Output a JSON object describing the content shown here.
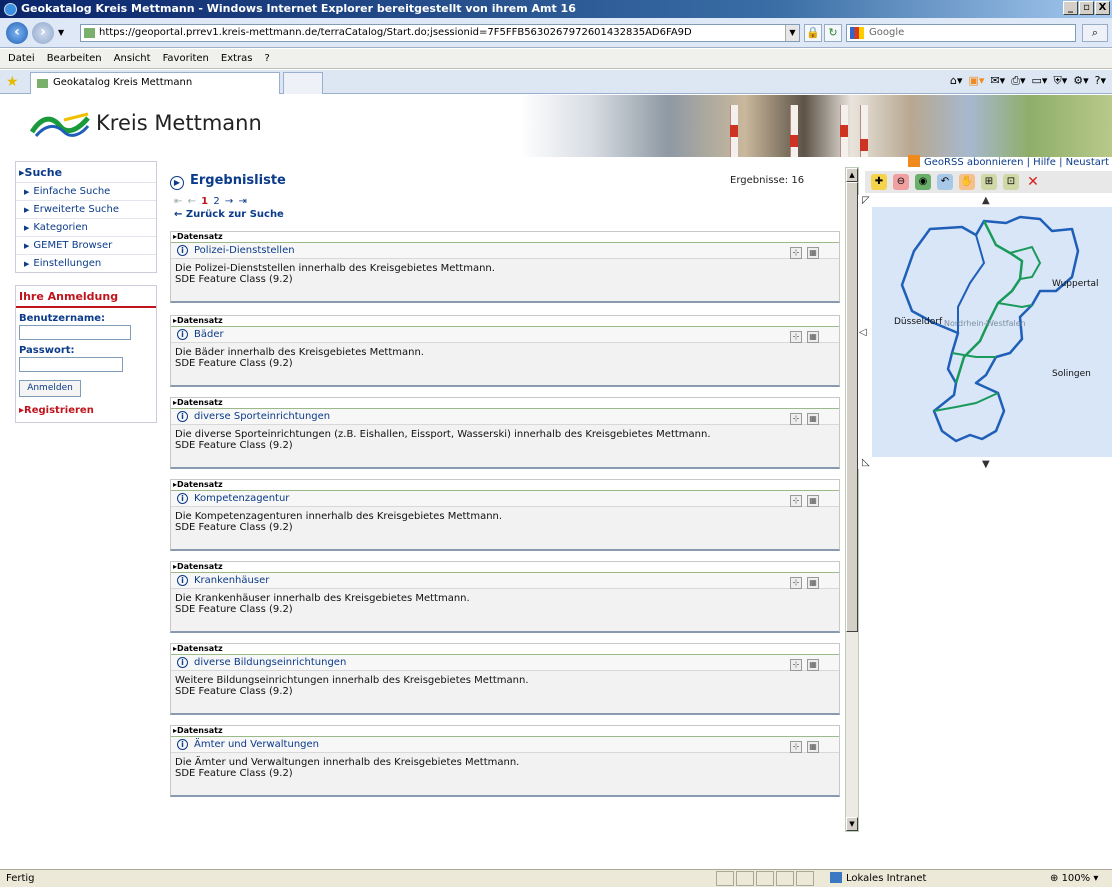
{
  "window": {
    "title": "Geokatalog Kreis Mettmann - Windows Internet Explorer bereitgestellt von ihrem Amt 16",
    "controls": [
      "_",
      "▫",
      "X"
    ]
  },
  "address": {
    "url": "https://geoportal.prrev1.kreis-mettmann.de/terraCatalog/Start.do;jsessionid=7F5FFB5630267972601432835AD6FA9D",
    "search_placeholder": "Google"
  },
  "menu": [
    "Datei",
    "Bearbeiten",
    "Ansicht",
    "Favoriten",
    "Extras",
    "?"
  ],
  "tab": {
    "label": "Geokatalog Kreis Mettmann"
  },
  "banner": {
    "brand": "Kreis Mettmann"
  },
  "sidebar": {
    "search_heading": "Suche",
    "items": [
      "Einfache Suche",
      "Erweiterte Suche",
      "Kategorien",
      "GEMET Browser",
      "Einstellungen"
    ],
    "login_heading": "Ihre Anmeldung",
    "username_label": "Benutzername:",
    "password_label": "Passwort:",
    "login_button": "Anmelden",
    "register_link": "Registrieren"
  },
  "results": {
    "title": "Ergebnisliste",
    "count_label": "Ergebnisse: 16",
    "pager": {
      "first": "⇤",
      "prev": "←",
      "current": "1",
      "next_page": "2",
      "next": "→",
      "last": "⇥"
    },
    "back_link": "← Zurück zur Suche",
    "record_header": "Datensatz",
    "records": [
      {
        "name": "Polizei-Dienststellen",
        "description": "Die Polizei-Dienststellen innerhalb des Kreisgebietes Mettmann.",
        "type": "SDE Feature Class (9.2)"
      },
      {
        "name": "Bäder",
        "description": "Die Bäder innerhalb des Kreisgebietes Mettmann.",
        "type": "SDE Feature Class (9.2)"
      },
      {
        "name": "diverse Sporteinrichtungen",
        "description": "Die diverse Sporteinrichtungen (z.B. Eishallen, Eissport, Wasserski) innerhalb des Kreisgebietes Mettmann.",
        "type": "SDE Feature Class (9.2)"
      },
      {
        "name": "Kompetenzagentur",
        "description": "Die Kompetenzagenturen innerhalb des Kreisgebietes Mettmann.",
        "type": "SDE Feature Class (9.2)"
      },
      {
        "name": "Krankenhäuser",
        "description": "Die Krankenhäuser innerhalb des Kreisgebietes Mettmann.",
        "type": "SDE Feature Class (9.2)"
      },
      {
        "name": "diverse Bildungseinrichtungen",
        "description": "Weitere Bildungseinrichtungen innerhalb des Kreisgebietes Mettmann.",
        "type": "SDE Feature Class (9.2)"
      },
      {
        "name": "Ämter und Verwaltungen",
        "description": "Die Ämter und Verwaltungen innerhalb des Kreisgebietes Mettmann.",
        "type": "SDE Feature Class (9.2)"
      }
    ]
  },
  "top_links": {
    "rss": "GeoRSS abonnieren",
    "sep": " | ",
    "help": "Hilfe",
    "restart": "Neustart"
  },
  "map": {
    "labels": {
      "west": "Düsseldorf",
      "center": "Nordrhein-Westfalen",
      "east": "Wuppertal",
      "south": "Solingen"
    },
    "colors": {
      "background": "#d9e6f7",
      "boundary": "#1f5fb8",
      "internal": "#1a9a5a"
    }
  },
  "status": {
    "left": "Fertig",
    "zone": "Lokales Intranet",
    "zoom": "100%"
  }
}
